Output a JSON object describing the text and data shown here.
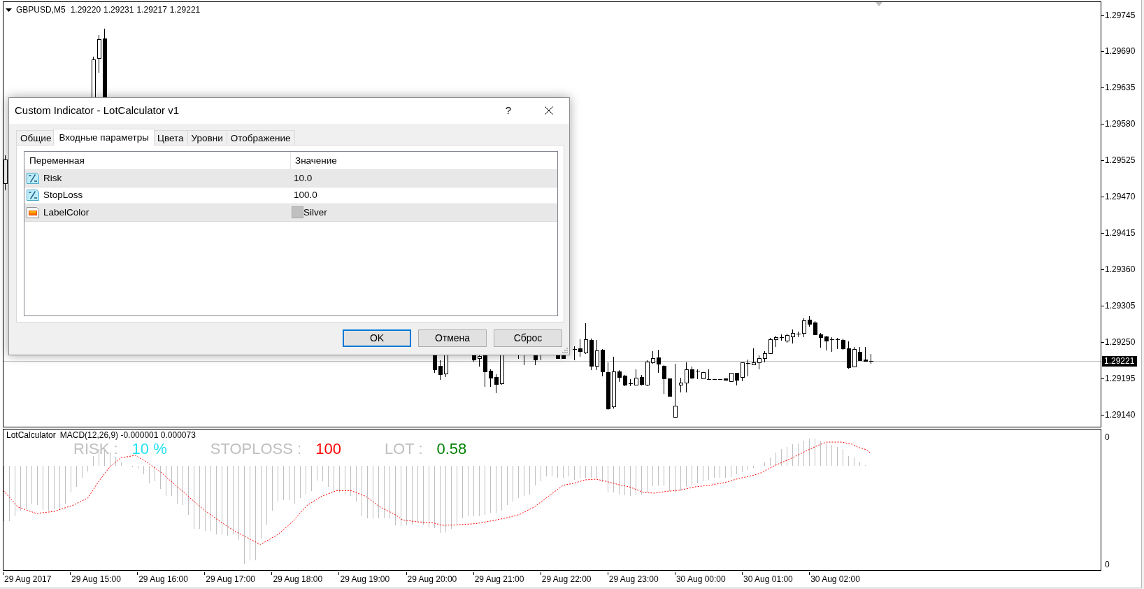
{
  "chart": {
    "header": {
      "symbol": "GBPUSD,M5",
      "prices": [
        "1.29220",
        "1.29231",
        "1.29217",
        "1.29221"
      ]
    },
    "price_axis": {
      "labels": [
        "1.29745",
        "1.29690",
        "1.29635",
        "1.29580",
        "1.29525",
        "1.29470",
        "1.29415",
        "1.29360",
        "1.29305",
        "1.29250",
        "1.29195",
        "1.29140"
      ],
      "current_price": "1.29221"
    }
  },
  "indicator": {
    "names": [
      "LotCalculator",
      "MACD(12,26,9) -0.000001 0.000073"
    ],
    "lot_calculator": [
      {
        "label": "RISK :",
        "value": "10 %",
        "color": "#22e1f0"
      },
      {
        "label": "STOPLOSS :",
        "value": "100",
        "color": "#ff0000"
      },
      {
        "label": "LOT :",
        "value": "0.58",
        "color": "#008000"
      }
    ],
    "axis_labels": [
      "0",
      "0"
    ]
  },
  "time_axis": {
    "labels": [
      "29 Aug 2017",
      "29 Aug 15:00",
      "29 Aug 16:00",
      "29 Aug 17:00",
      "29 Aug 18:00",
      "29 Aug 19:00",
      "29 Aug 20:00",
      "29 Aug 21:00",
      "29 Aug 22:00",
      "29 Aug 23:00",
      "30 Aug 00:00",
      "30 Aug 01:00",
      "30 Aug 02:00"
    ]
  },
  "dialog": {
    "title": "Custom Indicator - LotCalculator v1",
    "help": "?",
    "tabs": [
      {
        "label": "Общие",
        "selected": false
      },
      {
        "label": "Входные параметры",
        "selected": true
      },
      {
        "label": "Цвета",
        "selected": false
      },
      {
        "label": "Уровни",
        "selected": false
      },
      {
        "label": "Отображение",
        "selected": false
      }
    ],
    "parameters": {
      "columns": [
        "Переменная",
        "Значение"
      ],
      "rows": [
        {
          "kind": "number",
          "name": "Risk",
          "value": "10.0"
        },
        {
          "kind": "number",
          "name": "StopLoss",
          "value": "100.0"
        },
        {
          "kind": "color",
          "name": "LabelColor",
          "value": "Silver",
          "color": "#c0c0c0"
        }
      ]
    },
    "buttons": [
      {
        "label": "OK",
        "default": true
      },
      {
        "label": "Отмена",
        "default": false
      },
      {
        "label": "Сброс",
        "default": false
      }
    ]
  }
}
